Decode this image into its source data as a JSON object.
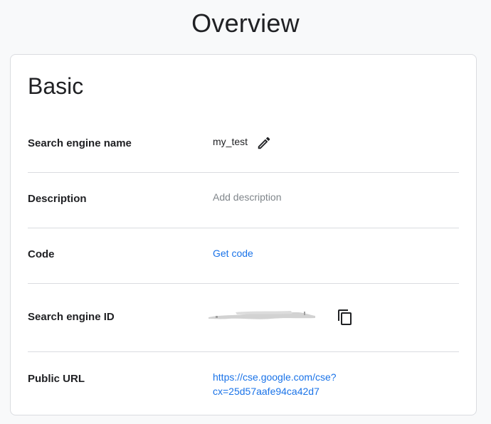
{
  "page": {
    "title": "Overview"
  },
  "basic": {
    "section_title": "Basic",
    "rows": {
      "name": {
        "label": "Search engine name",
        "value": "my_test",
        "action_icon": "pencil-edit-icon"
      },
      "description": {
        "label": "Description",
        "placeholder": "Add description"
      },
      "code": {
        "label": "Code",
        "link_text": "Get code"
      },
      "engine_id": {
        "label": "Search engine ID",
        "value_redacted": true,
        "action_icon": "copy-icon"
      },
      "public_url": {
        "label": "Public URL",
        "link_line1": "https://cse.google.com/cse?",
        "link_line2": "cx=25d57aafe94ca42d7"
      }
    }
  },
  "colors": {
    "link": "#1a73e8",
    "muted": "#80868b",
    "divider": "#dadce0",
    "text": "#202124"
  }
}
